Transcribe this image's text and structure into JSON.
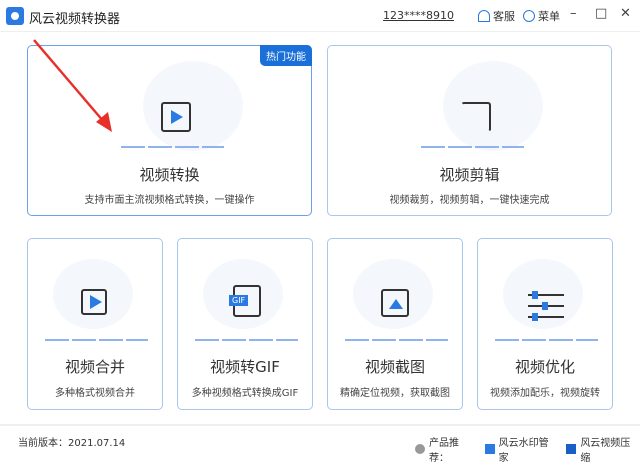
{
  "app": {
    "title": "风云视频转换器",
    "account": "123****8910",
    "support": "客服",
    "menu": "菜单"
  },
  "cards": [
    {
      "title": "视频转换",
      "desc": "支持市面主流视频格式转换，一键操作",
      "badge": "热门功能"
    },
    {
      "title": "视频剪辑",
      "desc": "视频裁剪，视频剪辑，一键快速完成"
    },
    {
      "title": "视频合并",
      "desc": "多种格式视频合并"
    },
    {
      "title": "视频转GIF",
      "desc": "多种视频格式转换成GIF",
      "icon_text": "GIF"
    },
    {
      "title": "视频截图",
      "desc": "精确定位视频，获取截图"
    },
    {
      "title": "视频优化",
      "desc": "视频添加配乐，视频旋转"
    }
  ],
  "footer": {
    "version": "当前版本：2021.07.14",
    "recommend": "产品推荐：",
    "products": [
      "风云水印管家",
      "风云视频压缩"
    ]
  },
  "colors": {
    "accent": "#1a6fd8",
    "annotation_arrow": "#e8302a"
  }
}
